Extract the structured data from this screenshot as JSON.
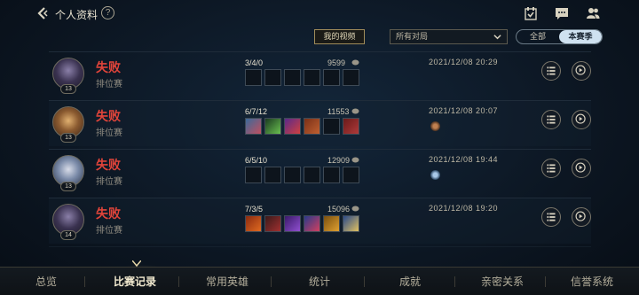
{
  "header": {
    "title": "个人资料",
    "help_glyph": "?",
    "icons": [
      "back-icon",
      "help-icon",
      "calendar-check-icon",
      "chat-icon",
      "friends-icon"
    ]
  },
  "toolbar": {
    "my_video": "我的视频",
    "match_filter": "所有对局",
    "season_all": "全部",
    "season_current": "本赛季"
  },
  "matches": [
    {
      "result": "失败",
      "mode": "排位赛",
      "level": "13",
      "kda": "3/4/0",
      "gold": "9599",
      "datetime": "2021/12/08 20:29",
      "items_filled": false,
      "badge": false
    },
    {
      "result": "失败",
      "mode": "排位赛",
      "level": "13",
      "kda": "6/7/12",
      "gold": "11553",
      "datetime": "2021/12/08 20:07",
      "items_filled": true,
      "badge": true
    },
    {
      "result": "失败",
      "mode": "排位赛",
      "level": "13",
      "kda": "6/5/10",
      "gold": "12909",
      "datetime": "2021/12/08 19:44",
      "items_filled": false,
      "badge": true
    },
    {
      "result": "失败",
      "mode": "排位赛",
      "level": "14",
      "kda": "7/3/5",
      "gold": "15096",
      "datetime": "2021/12/08 19:20",
      "items_filled": true,
      "badge": false
    }
  ],
  "nav": {
    "items": [
      "总览",
      "比赛记录",
      "常用英雄",
      "统计",
      "成就",
      "亲密关系",
      "信誉系统"
    ],
    "active": "比赛记录"
  },
  "colors": {
    "loss": "#e0443a",
    "accent_gold": "#a08c5a",
    "toggle_active": "#cfe1f0"
  }
}
